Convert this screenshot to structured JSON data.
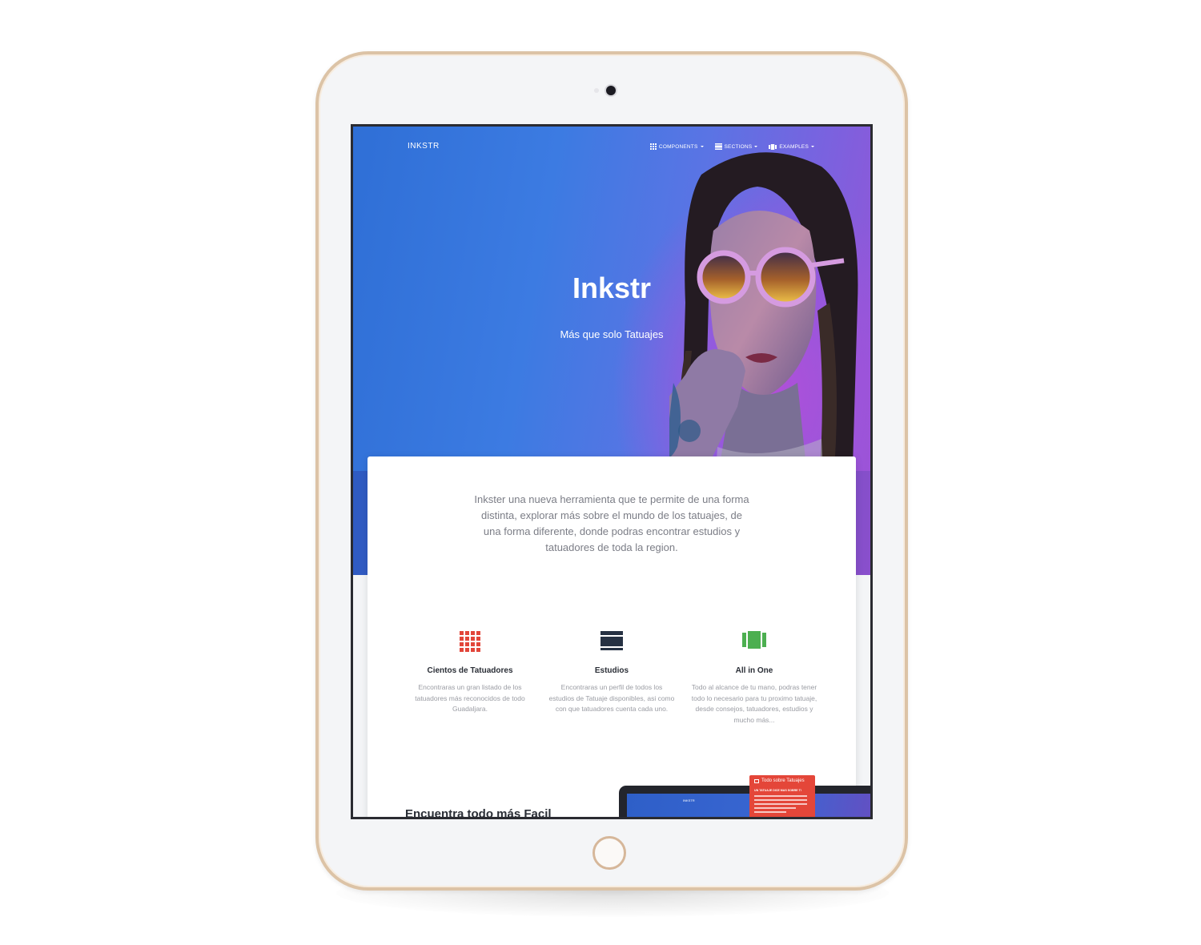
{
  "brand": "INKSTR",
  "nav": {
    "components": "COMPONENTS",
    "sections": "SECTIONS",
    "examples": "EXAMPLES"
  },
  "hero": {
    "title": "Inkstr",
    "subtitle": "Más que solo Tatuajes"
  },
  "intro": "Inkster una nueva herramienta que te permite de una forma distinta, explorar más sobre el mundo de los tatuajes, de una forma diferente, donde podras encontrar estudios y tatuadores de toda la region.",
  "features": [
    {
      "icon": "grid-icon",
      "title": "Cientos de Tatuadores",
      "text": "Encontraras un gran listado de los tatuadores más reconocidos de todo Guadaljara."
    },
    {
      "icon": "view-list-icon",
      "title": "Estudios",
      "text": "Encontraras un perfil de todos los estudios de Tatuaje disponibles, asi como con que tatuadores cuenta cada uno."
    },
    {
      "icon": "view-carousel-icon",
      "title": "All in One",
      "text": "Todo al alcance de tu mano, podras tener todo lo necesario para tu proximo tatuaje, desde consejos, tatuadores, estudios y mucho más..."
    }
  ],
  "bottom": {
    "title": "Encuentra todo más Facil",
    "preview_card_title": "Todo sobre Tatuajes",
    "preview_card_sub": "UN TATUAJE DICE MAS SOBRE TI",
    "preview_brand": "INKSTR"
  },
  "colors": {
    "accent_red": "#e2463a",
    "dark_navy": "#263143",
    "green": "#4caf50",
    "hero_blue": "#3c7be2",
    "hero_purple": "#9b52d4"
  }
}
